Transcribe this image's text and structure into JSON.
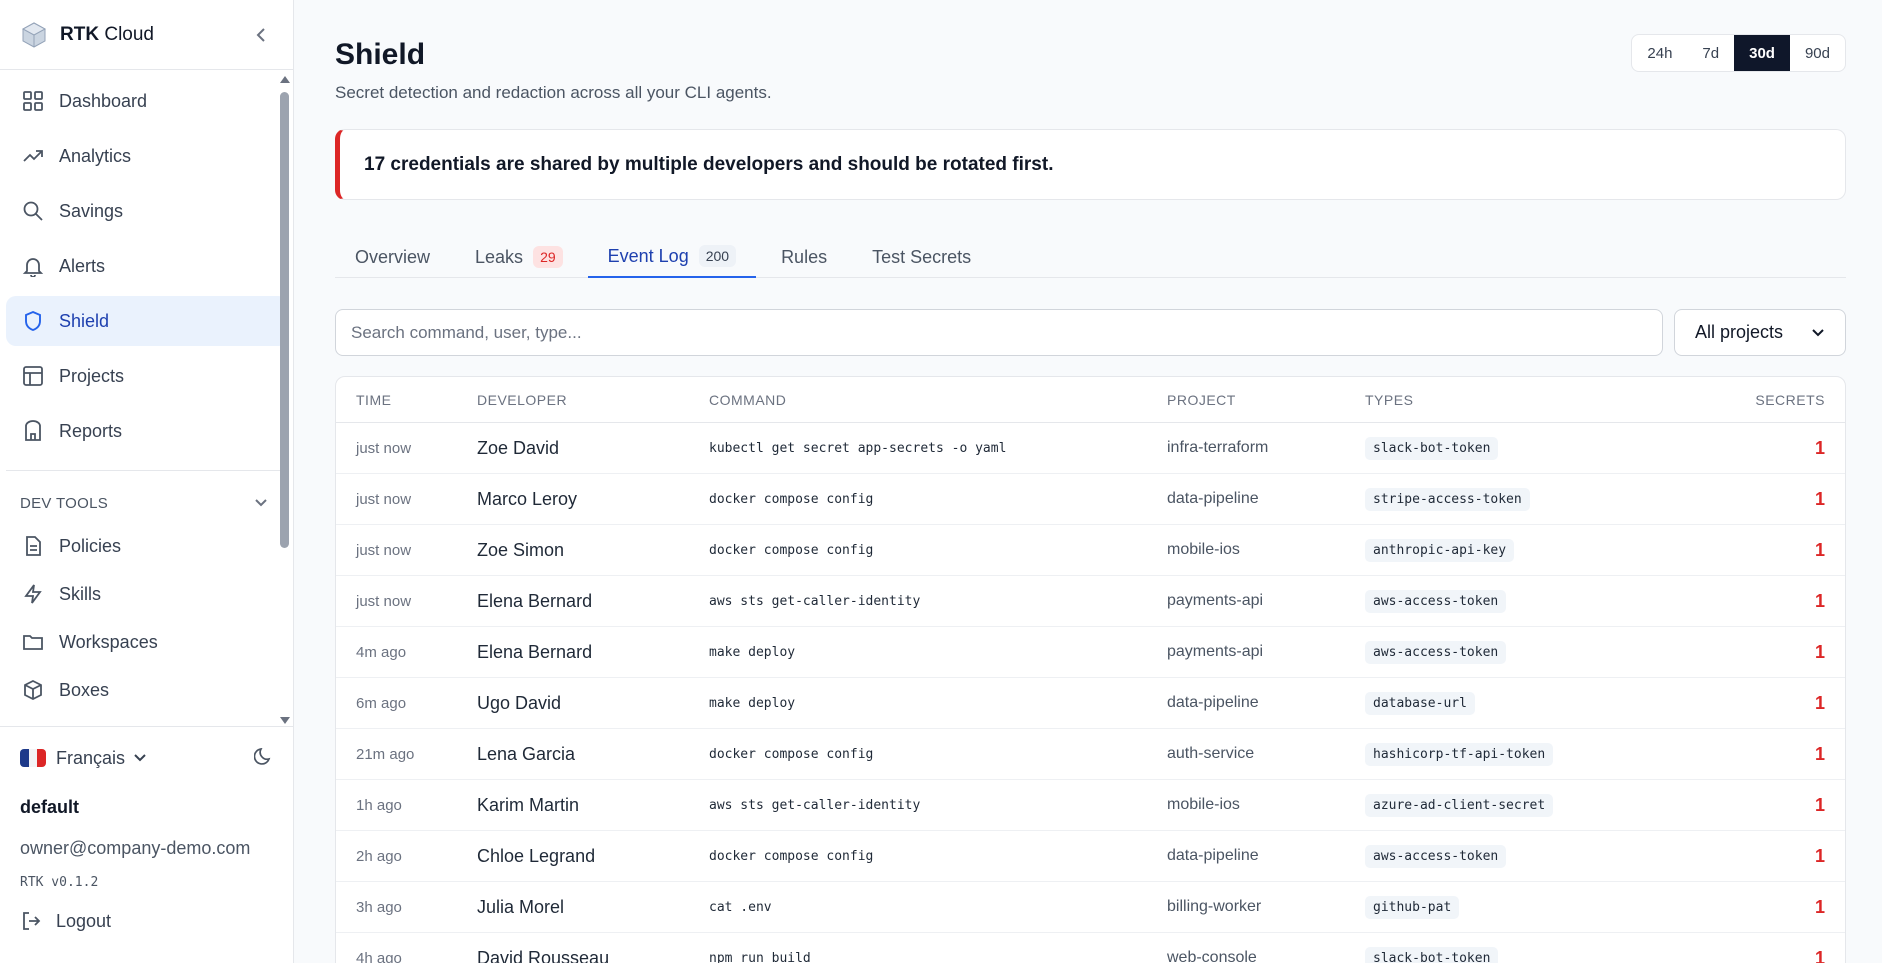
{
  "brand": {
    "name_bold": "RTK",
    "name_rest": " Cloud"
  },
  "nav": {
    "items": [
      {
        "label": "Dashboard",
        "icon": "grid-icon"
      },
      {
        "label": "Analytics",
        "icon": "trend-icon"
      },
      {
        "label": "Savings",
        "icon": "search-icon"
      },
      {
        "label": "Alerts",
        "icon": "bell-icon"
      },
      {
        "label": "Shield",
        "icon": "shield-icon",
        "active": true
      },
      {
        "label": "Projects",
        "icon": "table-icon"
      },
      {
        "label": "Reports",
        "icon": "report-icon"
      }
    ],
    "section_title": "DEV TOOLS",
    "dev_items": [
      {
        "label": "Policies",
        "icon": "document-icon"
      },
      {
        "label": "Skills",
        "icon": "bolt-icon"
      },
      {
        "label": "Workspaces",
        "icon": "folder-icon"
      },
      {
        "label": "Boxes",
        "icon": "box-icon"
      }
    ]
  },
  "footer": {
    "language": "Français",
    "org": "default",
    "email": "owner@company-demo.com",
    "version": "RTK v0.1.2",
    "logout": "Logout"
  },
  "header": {
    "title": "Shield",
    "subtitle": "Secret detection and redaction across all your CLI agents.",
    "ranges": [
      "24h",
      "7d",
      "30d",
      "90d"
    ],
    "selected_range": "30d"
  },
  "alert": {
    "text": "17 credentials are shared by multiple developers and should be rotated first.",
    "color": "#dc2626"
  },
  "tabs": [
    {
      "label": "Overview"
    },
    {
      "label": "Leaks",
      "badge": "29"
    },
    {
      "label": "Event Log",
      "badge": "200",
      "active": true
    },
    {
      "label": "Rules"
    },
    {
      "label": "Test Secrets"
    }
  ],
  "search": {
    "placeholder": "Search command, user, type...",
    "value": ""
  },
  "project_filter": {
    "selected": "All projects"
  },
  "table": {
    "headers": {
      "time": "TIME",
      "developer": "DEVELOPER",
      "command": "COMMAND",
      "project": "PROJECT",
      "types": "TYPES",
      "secrets": "SECRETS"
    },
    "rows": [
      {
        "time": "just now",
        "developer": "Zoe David",
        "command": "kubectl get secret app-secrets -o yaml",
        "project": "infra-terraform",
        "type": "slack-bot-token",
        "secrets": "1"
      },
      {
        "time": "just now",
        "developer": "Marco Leroy",
        "command": "docker compose config",
        "project": "data-pipeline",
        "type": "stripe-access-token",
        "secrets": "1"
      },
      {
        "time": "just now",
        "developer": "Zoe Simon",
        "command": "docker compose config",
        "project": "mobile-ios",
        "type": "anthropic-api-key",
        "secrets": "1"
      },
      {
        "time": "just now",
        "developer": "Elena Bernard",
        "command": "aws sts get-caller-identity",
        "project": "payments-api",
        "type": "aws-access-token",
        "secrets": "1"
      },
      {
        "time": "4m ago",
        "developer": "Elena Bernard",
        "command": "make deploy",
        "project": "payments-api",
        "type": "aws-access-token",
        "secrets": "1"
      },
      {
        "time": "6m ago",
        "developer": "Ugo David",
        "command": "make deploy",
        "project": "data-pipeline",
        "type": "database-url",
        "secrets": "1"
      },
      {
        "time": "21m ago",
        "developer": "Lena Garcia",
        "command": "docker compose config",
        "project": "auth-service",
        "type": "hashicorp-tf-api-token",
        "secrets": "1"
      },
      {
        "time": "1h ago",
        "developer": "Karim Martin",
        "command": "aws sts get-caller-identity",
        "project": "mobile-ios",
        "type": "azure-ad-client-secret",
        "secrets": "1"
      },
      {
        "time": "2h ago",
        "developer": "Chloe Legrand",
        "command": "docker compose config",
        "project": "data-pipeline",
        "type": "aws-access-token",
        "secrets": "1"
      },
      {
        "time": "3h ago",
        "developer": "Julia Morel",
        "command": "cat .env",
        "project": "billing-worker",
        "type": "github-pat",
        "secrets": "1"
      },
      {
        "time": "4h ago",
        "developer": "David Rousseau",
        "command": "npm run build",
        "project": "web-console",
        "type": "slack-bot-token",
        "secrets": "1"
      }
    ]
  }
}
